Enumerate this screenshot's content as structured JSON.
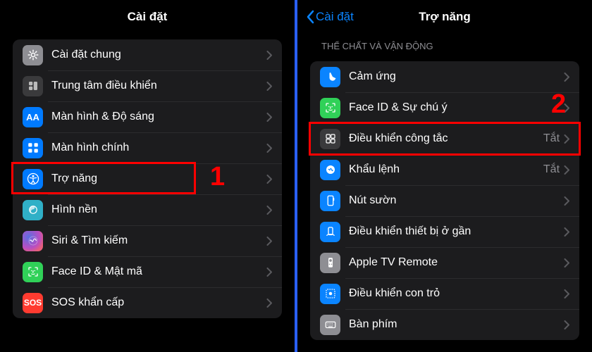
{
  "left": {
    "title": "Cài đặt",
    "rows": [
      {
        "label": "Cài đặt chung",
        "icon": "gear",
        "bg": "bg-gray"
      },
      {
        "label": "Trung tâm điều khiển",
        "icon": "controlcenter",
        "bg": "bg-dgray"
      },
      {
        "label": "Màn hình & Độ sáng",
        "icon": "aa",
        "bg": "bg-blue"
      },
      {
        "label": "Màn hình chính",
        "icon": "apps",
        "bg": "bg-blue"
      },
      {
        "label": "Trợ năng",
        "icon": "accessibility",
        "bg": "bg-blue"
      },
      {
        "label": "Hình nền",
        "icon": "wallpaper",
        "bg": "bg-cyan"
      },
      {
        "label": "Siri & Tìm kiếm",
        "icon": "siri",
        "bg": "bg-sirigrad"
      },
      {
        "label": "Face ID & Mật mã",
        "icon": "faceid",
        "bg": "bg-green"
      },
      {
        "label": "SOS khẩn cấp",
        "icon": "sos",
        "bg": "bg-red"
      }
    ],
    "highlight_index": 4,
    "marker": "1"
  },
  "right": {
    "title": "Trợ năng",
    "back": "Cài đặt",
    "section": "THỂ CHẤT VÀ VẬN ĐỘNG",
    "rows": [
      {
        "label": "Cảm ứng",
        "icon": "touch",
        "bg": "bg-blue2",
        "status": ""
      },
      {
        "label": "Face ID & Sự chú ý",
        "icon": "faceid",
        "bg": "bg-green",
        "status": ""
      },
      {
        "label": "Điều khiển công tắc",
        "icon": "switchctl",
        "bg": "bg-dgray",
        "status": "Tắt"
      },
      {
        "label": "Khẩu lệnh",
        "icon": "voice",
        "bg": "bg-blue2",
        "status": "Tắt"
      },
      {
        "label": "Nút sườn",
        "icon": "sidebtn",
        "bg": "bg-blue2",
        "status": ""
      },
      {
        "label": "Điều khiển thiết bị ở gần",
        "icon": "nearby",
        "bg": "bg-blue2",
        "status": ""
      },
      {
        "label": "Apple TV Remote",
        "icon": "remote",
        "bg": "bg-gray",
        "status": ""
      },
      {
        "label": "Điều khiển con trỏ",
        "icon": "pointer",
        "bg": "bg-blue2",
        "status": ""
      },
      {
        "label": "Bàn phím",
        "icon": "keyboard",
        "bg": "bg-gray",
        "status": ""
      }
    ],
    "highlight_index": 2,
    "marker": "2"
  }
}
